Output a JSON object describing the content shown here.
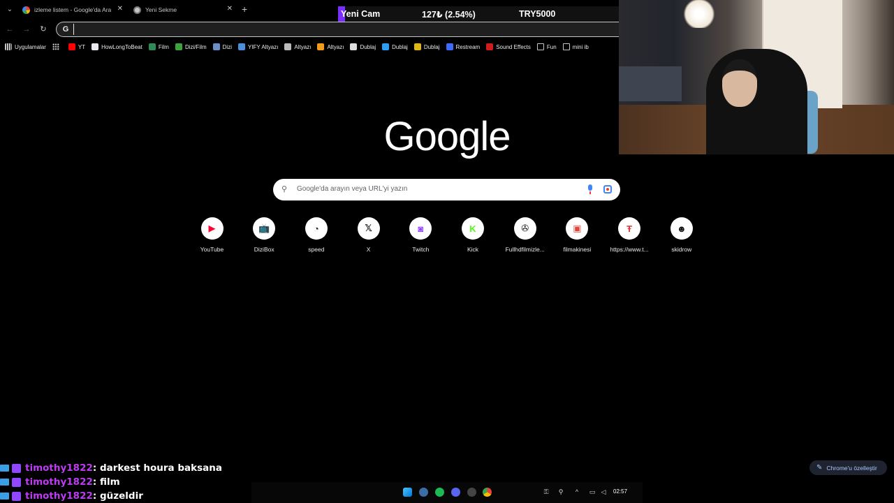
{
  "tabs": [
    {
      "title": "izleme listem - Google'da Ara",
      "active": false,
      "favicon": "google-g-icon"
    },
    {
      "title": "Yeni Sekme",
      "active": true,
      "favicon": "chrome-icon"
    }
  ],
  "ticker": {
    "name": "Yeni Cam",
    "change": "127₺ (2.54%)",
    "price": "TRY5000",
    "accent": "#7b2fff"
  },
  "omnibox": {
    "value": "",
    "icon": "google-g-icon"
  },
  "bookmarks": [
    {
      "label": "Uygulamalar",
      "icon": "apps-icon",
      "color": "#c4c7c5"
    },
    {
      "label": "",
      "icon": "grid-icon",
      "color": "#c4c7c5"
    },
    {
      "label": "YT",
      "icon": "youtube-icon",
      "color": "#ff0000"
    },
    {
      "label": "HowLongToBeat",
      "icon": "hltb-icon",
      "color": "#e8eaed"
    },
    {
      "label": "Film",
      "icon": "film-icon",
      "color": "#2e8b57"
    },
    {
      "label": "Dizi/Film",
      "icon": "dizifilm-icon",
      "color": "#3ca33c"
    },
    {
      "label": "Dizi",
      "icon": "dizi-icon",
      "color": "#6b8ec9"
    },
    {
      "label": "YIFY Altyazı",
      "icon": "yify-icon",
      "color": "#4a90d9"
    },
    {
      "label": "Altyazı",
      "icon": "altyazi-icon",
      "color": "#bbbbbb"
    },
    {
      "label": "Altyazı",
      "icon": "altyazi-orange-icon",
      "color": "#f59b1b"
    },
    {
      "label": "Dublaj",
      "icon": "dublaj-icon",
      "color": "#dddddd"
    },
    {
      "label": "Dublaj",
      "icon": "dublaj-blue-icon",
      "color": "#2a9df4"
    },
    {
      "label": "Dublaj",
      "icon": "dublaj-yellow-icon",
      "color": "#e2b714"
    },
    {
      "label": "Restream",
      "icon": "restream-icon",
      "color": "#3b6cff"
    },
    {
      "label": "Sound Effects",
      "icon": "sound-effects-icon",
      "color": "#d01c1c"
    },
    {
      "label": "Fun",
      "icon": "folder-icon",
      "color": "#c4c7c5"
    },
    {
      "label": "mini ib",
      "icon": "folder-icon",
      "color": "#c4c7c5"
    }
  ],
  "google": {
    "logo": "Google",
    "search_placeholder": "Google'da arayın veya URL'yi yazın"
  },
  "shortcuts": [
    {
      "label": "YouTube",
      "icon": "youtube-icon",
      "glyph": "▶",
      "color": "#ff0033"
    },
    {
      "label": "DiziBox",
      "icon": "tv-icon",
      "glyph": "📺",
      "color": "#333333"
    },
    {
      "label": "speed",
      "icon": "speedometer-icon",
      "glyph": "◔",
      "color": "#222222"
    },
    {
      "label": "X",
      "icon": "x-icon",
      "glyph": "𝕏",
      "color": "#000000"
    },
    {
      "label": "Twitch",
      "icon": "twitch-icon",
      "glyph": "◙",
      "color": "#9146ff"
    },
    {
      "label": "Kick",
      "icon": "kick-icon",
      "glyph": "K",
      "color": "#53fc18"
    },
    {
      "label": "Fullhdfilmizle...",
      "icon": "film-reel-icon",
      "glyph": "✇",
      "color": "#111111"
    },
    {
      "label": "filmakinesi",
      "icon": "filmakinesi-icon",
      "glyph": "▣",
      "color": "#e0443a"
    },
    {
      "label": "https://www.t...",
      "icon": "site-logo-icon",
      "glyph": "Ŧ",
      "color": "#d93a3a"
    },
    {
      "label": "skidrow",
      "icon": "skidrow-icon",
      "glyph": "☻",
      "color": "#111111"
    }
  ],
  "chat": [
    {
      "user": "timothy1822",
      "message": "darkest houra baksana"
    },
    {
      "user": "timothy1822",
      "message": "film"
    },
    {
      "user": "timothy1822",
      "message": "güzeldir"
    }
  ],
  "customize": {
    "label": "Chrome'u özelleştir"
  },
  "taskbar": {
    "time": "02:57"
  }
}
